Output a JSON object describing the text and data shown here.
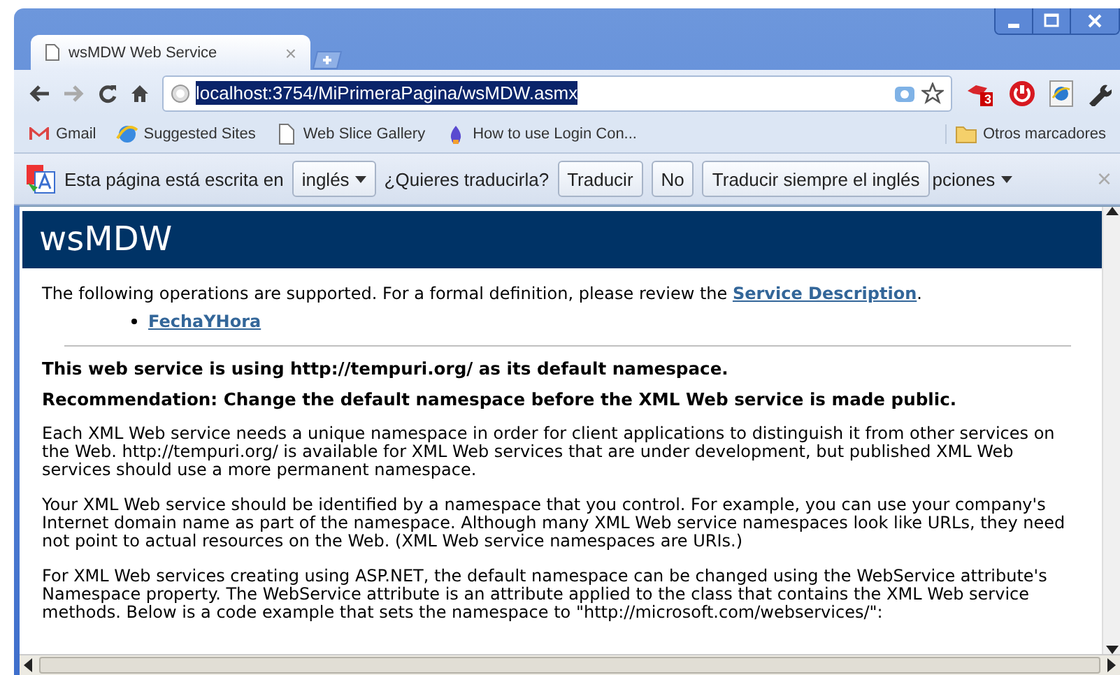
{
  "tabs": [
    {
      "title": "wsMDW Web Service",
      "close": "×",
      "selected": true
    }
  ],
  "address": {
    "value": "localhost:3754/MiPrimeraPagina/wsMDW.asmx",
    "selected": true
  },
  "extension_badge": "3",
  "bookmarks": [
    {
      "label": "Gmail",
      "kind": "gmail"
    },
    {
      "label": "Suggested Sites",
      "kind": "ie"
    },
    {
      "label": "Web Slice Gallery",
      "kind": "page"
    },
    {
      "label": "How to use Login Con...",
      "kind": "drop"
    }
  ],
  "other_bookmarks": "Otros marcadores",
  "translate_bar": {
    "message": "Esta página está escrita en",
    "language": "inglés",
    "question": "¿Quieres traducirla?",
    "buttons": [
      "Traducir",
      "No",
      "Traducir siempre el inglés"
    ],
    "options": "pciones",
    "close": "×"
  },
  "page": {
    "title": "wsMDW",
    "intro": "The following operations are supported. For a formal definition, please review the ",
    "intro_link": "Service Description",
    "intro_end": ".",
    "operations": [
      "FechaYHora"
    ],
    "headings": [
      "This web service is using http://tempuri.org/ as its default namespace.",
      "Recommendation: Change the default namespace before the XML Web service is made public."
    ],
    "paragraphs": [
      "Each XML Web service needs a unique namespace in order for client applications to distinguish it from other services on the Web. http://tempuri.org/ is available for XML Web services that are under development, but published XML Web services should use a more permanent namespace.",
      "Your XML Web service should be identified by a namespace that you control. For example, you can use your company's Internet domain name as part of the namespace. Although many XML Web service namespaces look like URLs, they need not point to actual resources on the Web. (XML Web service namespaces are URIs.)",
      "For XML Web services creating using ASP.NET, the default namespace can be changed using the WebService attribute's Namespace property. The WebService attribute is an attribute applied to the class that contains the XML Web service methods. Below is a code example that sets the namespace to \"http://microsoft.com/webservices/\":"
    ]
  }
}
